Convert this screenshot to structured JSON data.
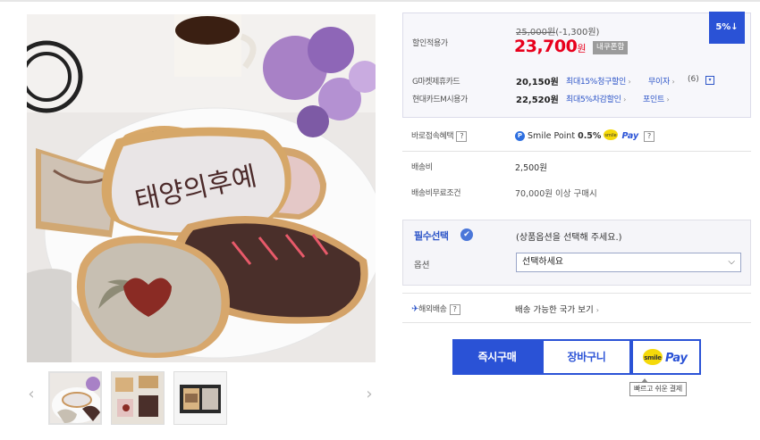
{
  "price": {
    "badge": "5%↓",
    "discount_label": "할인적용가",
    "original_price": "25,000원",
    "discount_amount": "(-1,300원)",
    "sale_price": "23,700",
    "sale_unit": "원",
    "coupon_label": "내쿠폰함"
  },
  "cards": [
    {
      "name": "G마켓제휴카드",
      "amount": "20,150원",
      "benefit": "최대15%청구할인",
      "extra": "무이자",
      "extra_count": "(6)"
    },
    {
      "name": "현대카드M시용가",
      "amount": "22,520원",
      "benefit": "최대5%차감할인",
      "extra": "포인트"
    }
  ],
  "direct_benefit": {
    "label": "바로접속혜택",
    "smile_point": "Smile Point",
    "rate": "0.5%",
    "pay_text": "Pay"
  },
  "shipping": {
    "fee_label": "배송비",
    "fee_value": "2,500원",
    "free_label": "배송비무료조건",
    "free_value": "70,000원 이상 구매시"
  },
  "options": {
    "required_label": "필수선택",
    "hint": "(상품옵션을 선택해 주세요.)",
    "option_label": "옵션",
    "selected": "선택하세요"
  },
  "overseas": {
    "label": "해외배송",
    "link": "배송 가능한 국가 보기"
  },
  "buttons": {
    "buy": "즉시구매",
    "cart": "장바구니",
    "smile_pay": "Pay",
    "smile_word": "smile"
  },
  "tooltip": "빠르고 쉬운 결제",
  "image_text": "태양의후예",
  "colors": {
    "accent_blue": "#2a52d6",
    "sale_red": "#e8001c",
    "link_blue": "#2d55c8"
  },
  "icons": [
    "chevron-left-icon",
    "chevron-right-icon",
    "question-icon",
    "check-circle-icon",
    "airplane-icon",
    "chevron-down-icon"
  ]
}
